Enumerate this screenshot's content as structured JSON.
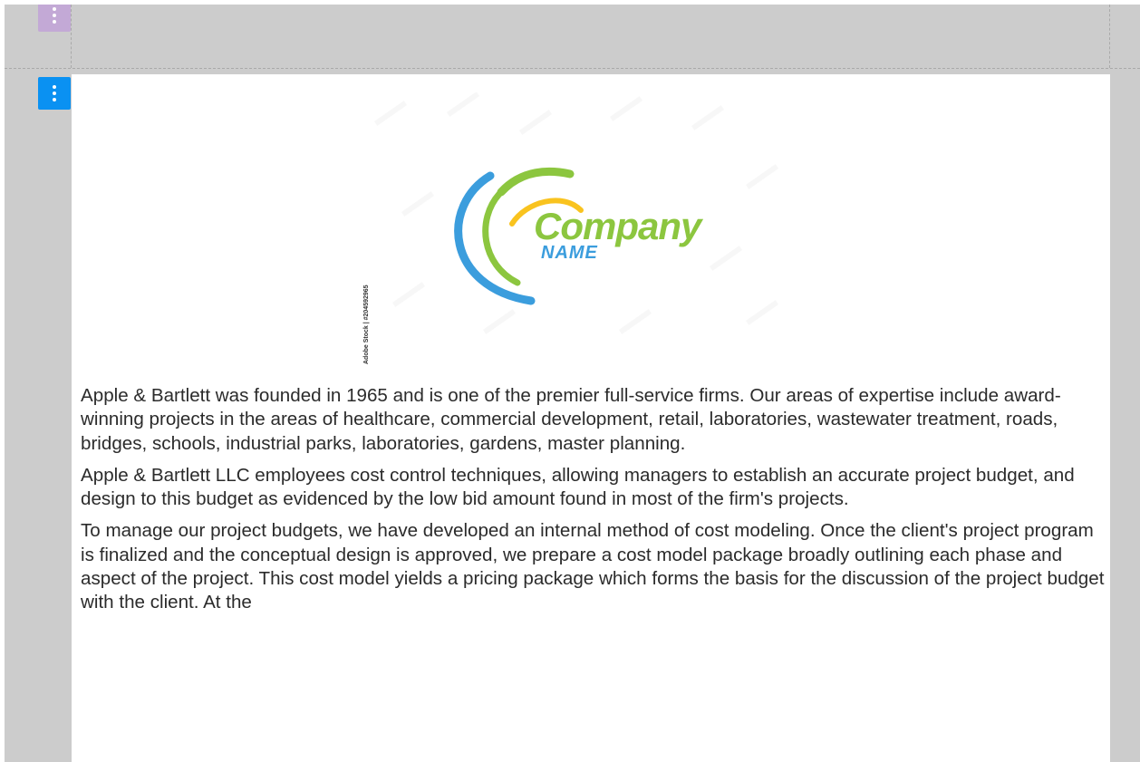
{
  "editor": {
    "prev_handle_icon": "vertical-ellipsis-icon",
    "active_handle_icon": "vertical-ellipsis-icon",
    "colors": {
      "canvas_bg": "#cccccc",
      "active_handle": "#0a91f2",
      "inactive_handle": "#c3a9d6",
      "content_bg": "#ffffff",
      "text": "#2b2b2b"
    }
  },
  "logo": {
    "word": "Company",
    "sub": "NAME",
    "credit": "Adobe Stock | #204592965",
    "colors": {
      "green": "#8cc63f",
      "blue": "#3b9ddd",
      "yellow": "#f9c31f"
    }
  },
  "paragraphs": [
    "Apple & Bartlett was founded in 1965 and is one of the premier full-service firms.  Our areas of expertise include award-winning projects in the areas of healthcare, commercial development, retail, laboratories, wastewater treatment, roads, bridges, schools, industrial parks, laboratories, gardens, master planning.",
    "Apple & Bartlett LLC employees cost control techniques, allowing managers to establish an accurate project budget, and design to this budget as evidenced by the low bid amount found in most of the firm's projects.",
    "To manage our project budgets, we have developed an internal method of cost modeling.  Once the client's project program is finalized and the conceptual design is approved, we prepare a cost model package broadly outlining each phase and aspect of the project.  This cost model yields a pricing package which forms the basis for the discussion of the project budget with the client.  At the"
  ]
}
